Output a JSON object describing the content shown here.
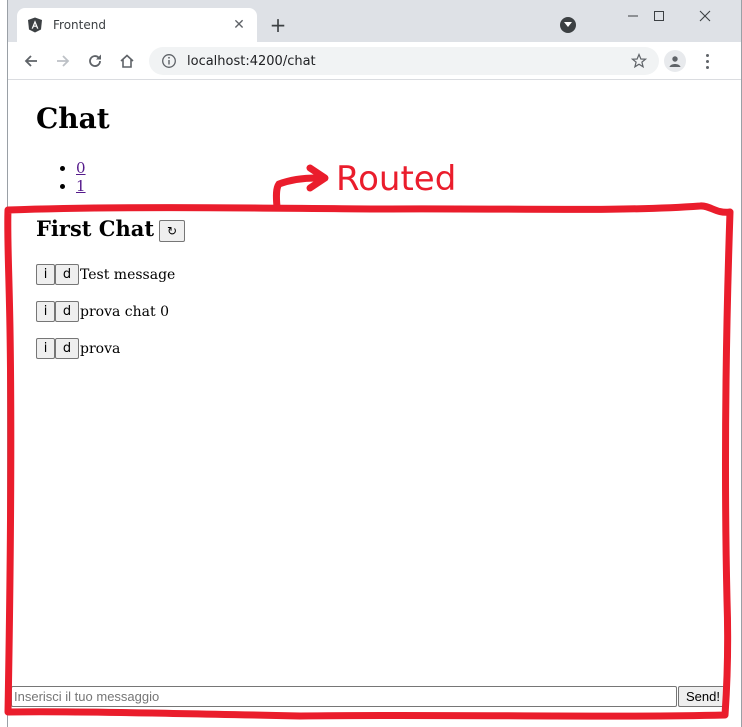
{
  "browser": {
    "tab_title": "Frontend",
    "new_tab_glyph": "+",
    "close_glyph": "✕",
    "url": "localhost:4200/chat",
    "icons": [
      "angular-logo-icon",
      "close-icon",
      "plus-icon",
      "minimize-icon",
      "maximize-icon",
      "window-close-icon",
      "back-arrow-icon",
      "forward-arrow-icon",
      "reload-icon",
      "home-icon",
      "info-icon",
      "star-icon",
      "account-icon",
      "kebab-menu-icon"
    ]
  },
  "page": {
    "title": "Chat",
    "chat_links": [
      "0",
      "1"
    ],
    "chat_heading": "First Chat",
    "refresh_glyph": "↻",
    "messages": [
      {
        "info_label": "i",
        "delete_label": "d",
        "text": "Test message"
      },
      {
        "info_label": "i",
        "delete_label": "d",
        "text": "prova chat 0"
      },
      {
        "info_label": "i",
        "delete_label": "d",
        "text": "prova"
      }
    ],
    "composer": {
      "placeholder": "Inserisci il tuo messaggio",
      "send_label": "Send!"
    }
  },
  "annotation": {
    "label": "Routed",
    "color": "#ea1d2c"
  }
}
